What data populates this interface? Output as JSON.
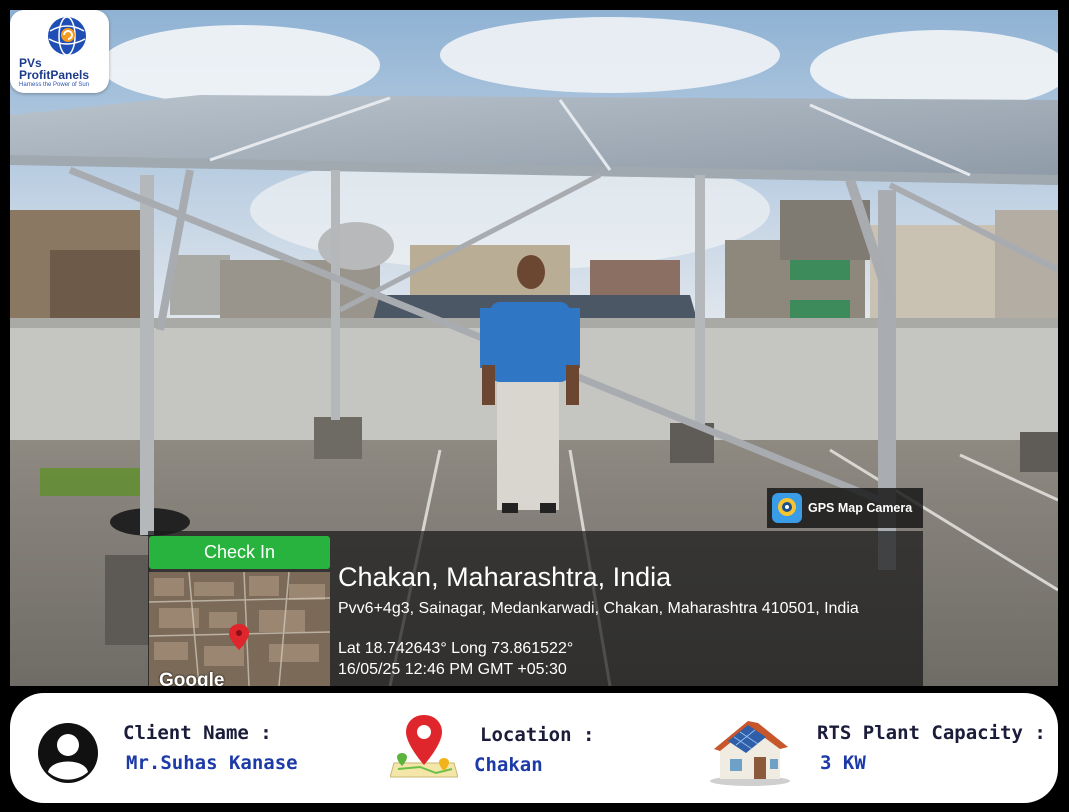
{
  "logo": {
    "line1": "PVs",
    "line2": "ProfitPanels",
    "tagline": "Harness the Power of Sun"
  },
  "gps_badge": {
    "label": "GPS Map Camera"
  },
  "overlay": {
    "check_in": "Check In",
    "map_watermark": "Google",
    "location_title": "Chakan, Maharashtra, India",
    "address": "Pvv6+4g3, Sainagar, Medankarwadi, Chakan, Maharashtra 410501, India",
    "lat_long": "Lat 18.742643° Long 73.861522°",
    "datetime": "16/05/25 12:46 PM GMT +05:30"
  },
  "info_bar": {
    "client_label": "Client Name :",
    "client_value": "Mr.Suhas Kanase",
    "location_label": "Location :",
    "location_value": "Chakan",
    "capacity_label": "RTS Plant Capacity :",
    "capacity_value": "3 KW"
  },
  "colors": {
    "check_in_green": "#27b33d",
    "value_blue": "#1c3aa8",
    "pin_red": "#e0262d"
  },
  "icons": [
    "user-avatar-icon",
    "map-pin-icon",
    "solar-house-icon",
    "gps-camera-icon",
    "globe-logo-icon"
  ]
}
